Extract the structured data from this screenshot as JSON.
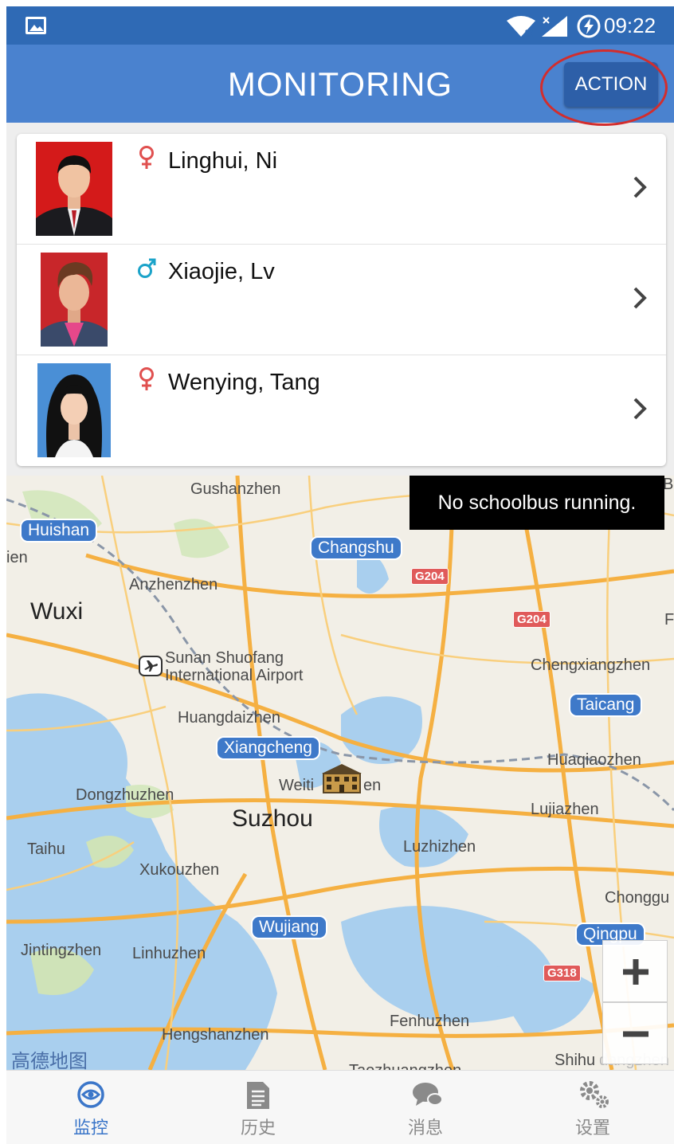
{
  "status_bar": {
    "time": "09:22"
  },
  "app_bar": {
    "title": "MONITORING",
    "action_label": "ACTION"
  },
  "students": [
    {
      "name": "Linghui, Ni",
      "gender": "female"
    },
    {
      "name": "Xiaojie, Lv",
      "gender": "male"
    },
    {
      "name": "Wenying, Tang",
      "gender": "female"
    }
  ],
  "map": {
    "toast": "No schoolbus running.",
    "logo": "高德地图",
    "labels": {
      "gushanzhen": "Gushanzhen",
      "huishan": "Huishan",
      "en": "ien",
      "changshu": "Changshu",
      "g204a": "G204",
      "anzhenzhen": "Anzhenzhen",
      "wuxi": "Wuxi",
      "g204b": "G204",
      "airport1": "Sunan Shuofang",
      "airport2": "International Airport",
      "chengxiangzhen": "Chengxiangzhen",
      "taicang": "Taicang",
      "huangdaizhen": "Huangdaizhen",
      "xiangcheng": "Xiangcheng",
      "huaqiaozhen": "Huaqiaozhen",
      "weiting": "Weiti",
      "weiting_tail": "en",
      "dongzhuzhen": "Dongzhuzhen",
      "lujiazhen": "Lujiazhen",
      "suzhou": "Suzhou",
      "taihu": "Taihu",
      "luzhizhen": "Luzhizhen",
      "xukouzhen": "Xukouzhen",
      "chonggu": "Chonggu",
      "wujiang": "Wujiang",
      "qingpu": "Qingpu",
      "jintingzhen": "Jintingzhen",
      "linhuzhen": "Linhuzhen",
      "g318": "G318",
      "fenhuzhen": "Fenhuzhen",
      "hengshanzhen": "Hengshanzhen",
      "shihu": "Shihu",
      "shihu_tail": "dangzhen",
      "taozhuang": "Taozhuangzhen",
      "f_edge": "F",
      "bu_edge": "Bu"
    }
  },
  "nav": [
    {
      "label": "监控",
      "icon": "monitor-icon",
      "active": true
    },
    {
      "label": "历史",
      "icon": "history-icon",
      "active": false
    },
    {
      "label": "消息",
      "icon": "message-icon",
      "active": false
    },
    {
      "label": "设置",
      "icon": "settings-icon",
      "active": false
    }
  ],
  "colors": {
    "primary": "#4a82cf",
    "status_bar": "#2f6ab5",
    "action_btn": "#2d5fa8",
    "female": "#e0504f",
    "male": "#1ba3c9",
    "active_tab": "#3b76c9"
  }
}
